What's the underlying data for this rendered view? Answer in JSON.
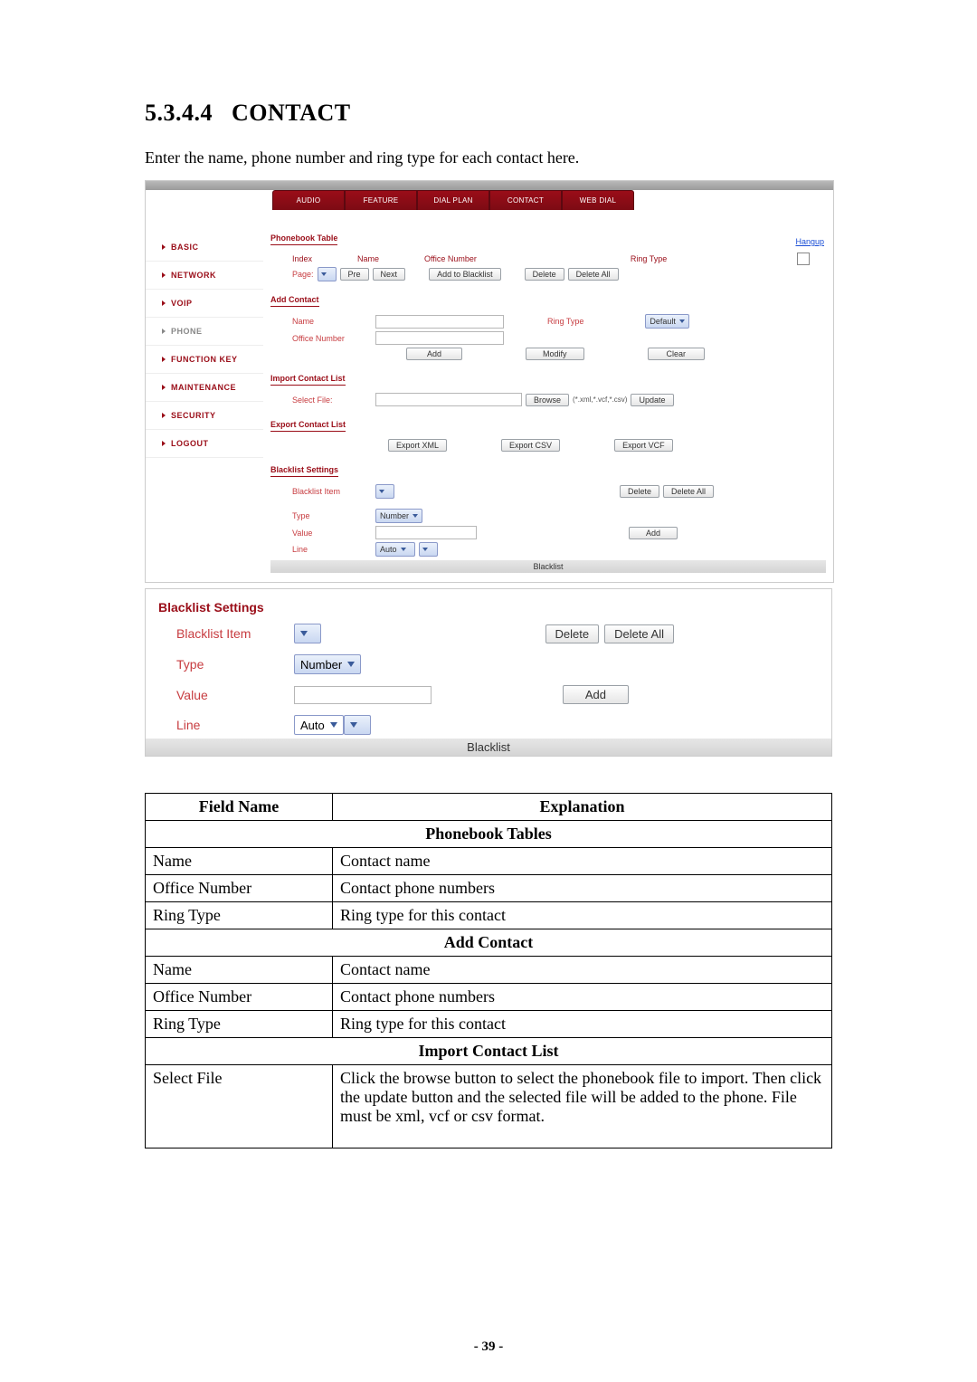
{
  "heading_number": "5.3.4.4",
  "heading_word": "CONTACT",
  "intro": "Enter the name, phone number and ring type for each contact here.",
  "page_number": "- 39 -",
  "screenshot": {
    "tabs": [
      "AUDIO",
      "FEATURE",
      "DIAL PLAN",
      "CONTACT",
      "WEB DIAL"
    ],
    "sidebar": [
      "BASIC",
      "NETWORK",
      "VOIP",
      "PHONE",
      "FUNCTION KEY",
      "MAINTENANCE",
      "SECURITY",
      "LOGOUT"
    ],
    "hangup": "Hangup",
    "phonebook": {
      "title": "Phonebook Table",
      "cols": [
        "Index",
        "Name",
        "Office Number",
        "Ring Type"
      ],
      "page_label": "Page:",
      "pre_btn": "Pre",
      "next_btn": "Next",
      "add_bl_btn": "Add to Blacklist",
      "delete_btn": "Delete",
      "delete_all_btn": "Delete All"
    },
    "addcontact": {
      "title": "Add Contact",
      "name_label": "Name",
      "office_label": "Office Number",
      "ring_label": "Ring Type",
      "ring_sel": "Default",
      "add_btn": "Add",
      "modify_btn": "Modify",
      "clear_btn": "Clear"
    },
    "importcl": {
      "title": "Import Contact List",
      "select_label": "Select File:",
      "browse_btn": "Browse",
      "file_note": "(*.xml,*.vcf,*.csv)",
      "update_btn": "Update"
    },
    "exportcl": {
      "title": "Export Contact List",
      "xml_btn": "Export XML",
      "csv_btn": "Export CSV",
      "vcf_btn": "Export VCF"
    },
    "blset": {
      "title": "Blacklist Settings",
      "item_label": "Blacklist Item",
      "delete_btn": "Delete",
      "delete_all_btn": "Delete All",
      "type_label": "Type",
      "type_sel": "Number",
      "value_label": "Value",
      "add_btn": "Add",
      "line_label": "Line",
      "line_sel": "Auto",
      "bar": "Blacklist"
    }
  },
  "enlarged": {
    "title": "Blacklist Settings",
    "item_label": "Blacklist Item",
    "delete_btn": "Delete",
    "delete_all_btn": "Delete All",
    "type_label": "Type",
    "type_sel": "Number",
    "value_label": "Value",
    "add_btn": "Add",
    "line_label": "Line",
    "line_sel": "Auto",
    "bar": "Blacklist"
  },
  "table": {
    "head_field": "Field Name",
    "head_exp": "Explanation",
    "group1": "Phonebook Tables",
    "r1": {
      "f": "Name",
      "e": "Contact name"
    },
    "r2": {
      "f": "Office Number",
      "e": "Contact phone numbers"
    },
    "r3": {
      "f": "Ring Type",
      "e": "Ring type for this contact"
    },
    "group2": "Add Contact",
    "r4": {
      "f": "Name",
      "e": "Contact name"
    },
    "r5": {
      "f": "Office Number",
      "e": "Contact phone numbers"
    },
    "r6": {
      "f": "Ring Type",
      "e": "Ring type for this contact"
    },
    "group3": "Import Contact List",
    "r7": {
      "f": "Select File",
      "e": "Click the browse button to select the phonebook file to import. Then click the update button and the selected file will be added to the phone. File must be xml, vcf or csv format."
    }
  }
}
